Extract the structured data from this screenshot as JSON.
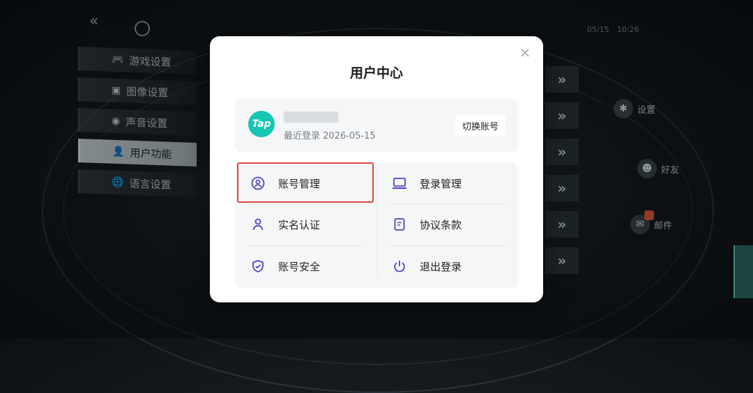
{
  "background": {
    "back_icon": "double-chevron-left-icon",
    "status_left": "05/15",
    "status_right": "10:26",
    "left_menu": [
      {
        "label": "游戏设置",
        "icon": "gamepad-icon",
        "glyph": "🎮",
        "active": false
      },
      {
        "label": "图像设置",
        "icon": "image-icon",
        "glyph": "▣",
        "active": false
      },
      {
        "label": "声音设置",
        "icon": "sound-icon",
        "glyph": "◉",
        "active": false
      },
      {
        "label": "用户功能",
        "icon": "user-icon",
        "glyph": "👤",
        "active": true
      },
      {
        "label": "语言设置",
        "icon": "globe-icon",
        "glyph": "🌐",
        "active": false
      }
    ],
    "chevron_glyph": "»",
    "side_actions": {
      "settings": "设置",
      "friends": "好友",
      "mail": "邮件"
    }
  },
  "dialog": {
    "title": "用户中心",
    "close_glyph": "✕",
    "account": {
      "logo_text": "Tap",
      "last_login": "最近登录 2026-05-15",
      "switch_label": "切换账号"
    },
    "items": [
      {
        "label": "账号管理",
        "icon": "user-circle-icon"
      },
      {
        "label": "登录管理",
        "icon": "laptop-icon"
      },
      {
        "label": "实名认证",
        "icon": "person-icon"
      },
      {
        "label": "协议条款",
        "icon": "document-icon"
      },
      {
        "label": "账号安全",
        "icon": "shield-check-icon"
      },
      {
        "label": "退出登录",
        "icon": "power-icon"
      }
    ],
    "accent_color": "#4e43c9",
    "highlight_color": "#e0453f"
  }
}
